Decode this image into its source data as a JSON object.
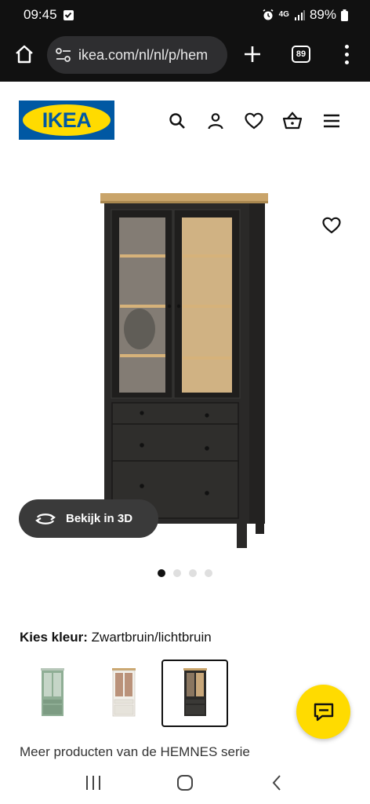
{
  "status_bar": {
    "time": "09:45",
    "network": "4G",
    "battery": "89%"
  },
  "browser": {
    "url": "ikea.com/nl/nl/p/hem",
    "tab_count": "89"
  },
  "header": {
    "logo_text": "IKEA",
    "icons": [
      "search-icon",
      "account-icon",
      "wishlist-icon",
      "basket-icon",
      "hamburger-menu-icon"
    ]
  },
  "product": {
    "view_3d_label": "Bekijk in 3D",
    "carousel_dots": 4,
    "active_dot": 0
  },
  "color_select": {
    "label": "Kies kleur:",
    "value": "Zwartbruin/lichtbruin",
    "swatches": [
      {
        "name": "green",
        "color": "#8fae95",
        "selected": false
      },
      {
        "name": "white",
        "color": "#f2f0ea",
        "selected": false
      },
      {
        "name": "black-brown",
        "color": "#2b2a28",
        "selected": true
      }
    ]
  },
  "more_products": "Meer producten van de HEMNES serie",
  "colors": {
    "ikea_blue": "#0058a3",
    "ikea_yellow": "#ffdb00",
    "cabinet": "#2a2928",
    "wood_top": "#c9a46a"
  }
}
